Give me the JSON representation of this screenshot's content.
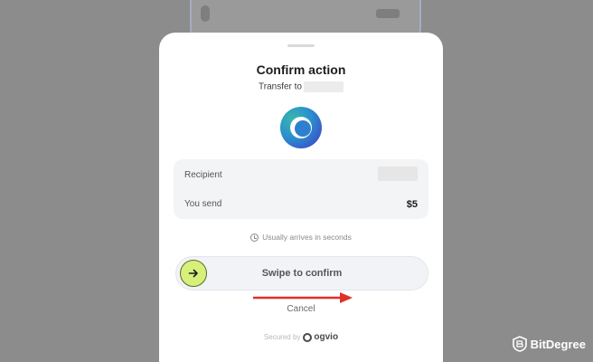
{
  "dialog": {
    "title": "Confirm action",
    "subtitle": "Transfer to",
    "details": {
      "recipient_label": "Recipient",
      "send_label": "You send",
      "send_value": "$5"
    },
    "arrival_note": "Usually arrives in seconds",
    "swipe_label": "Swipe to confirm",
    "cancel_label": "Cancel",
    "secured_by": "Secured by",
    "brand_name": "ogvio"
  },
  "watermark": {
    "text": "BitDegree"
  },
  "icons": {
    "swipe_handle": "arrow-right-icon",
    "arrival": "clock-icon",
    "annotation": "red-arrow-icon",
    "brand": "ogvio-logo-icon",
    "app_logo": "crescent-logo-icon"
  },
  "colors": {
    "overlay": "#8c8c8c",
    "swipe_handle": "#d7f07a",
    "annotation_arrow": "#e0302a"
  }
}
